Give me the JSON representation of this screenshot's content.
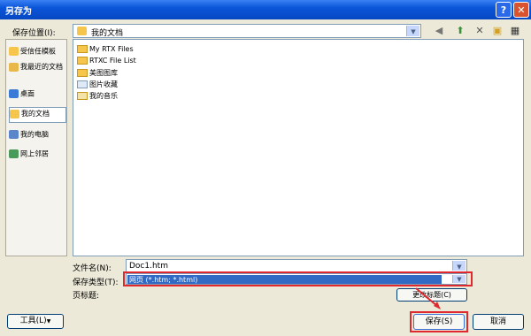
{
  "window": {
    "title": "另存为",
    "help_glyph": "?",
    "close_glyph": "✕"
  },
  "toolbar": {
    "save_in_label": "保存位置(I):",
    "save_in_value": "我的文档",
    "icons": [
      "back-icon",
      "up-folder-icon",
      "delete-icon",
      "new-folder-icon",
      "views-icon"
    ]
  },
  "places": [
    {
      "label": "受信任模板",
      "icon": "folder-icon",
      "color": "#f5c54c"
    },
    {
      "label": "我最近的文档",
      "icon": "recent-documents-icon",
      "color": "#e8b84a"
    },
    {
      "label": "桌面",
      "icon": "desktop-icon",
      "color": "#3a7bd5"
    },
    {
      "label": "我的文档",
      "icon": "my-documents-icon",
      "color": "#f5c54c",
      "selected": true
    },
    {
      "label": "我的电脑",
      "icon": "computer-icon",
      "color": "#5b86c9"
    },
    {
      "label": "网上邻居",
      "icon": "network-icon",
      "color": "#4a9a5a"
    }
  ],
  "files": [
    {
      "name": "My RTX Files",
      "icon": "folder-icon"
    },
    {
      "name": "RTXC File List",
      "icon": "folder-icon"
    },
    {
      "name": "美图图库",
      "icon": "folder-icon"
    },
    {
      "name": "图片收藏",
      "icon": "pictures-folder-icon"
    },
    {
      "name": "我的音乐",
      "icon": "music-folder-icon"
    }
  ],
  "form": {
    "filename_label": "文件名(N):",
    "filename_value": "Doc1.htm",
    "filetype_label": "保存类型(T):",
    "filetype_value": "网页 (*.htm; *.html)",
    "pagetitle_label": "页标题:",
    "change_title_button": "更改标题(C)"
  },
  "buttons": {
    "tools": "工具(L)",
    "save": "保存(S)",
    "cancel": "取消"
  },
  "colors": {
    "highlight": "#e0282e",
    "selection": "#316ac5"
  }
}
